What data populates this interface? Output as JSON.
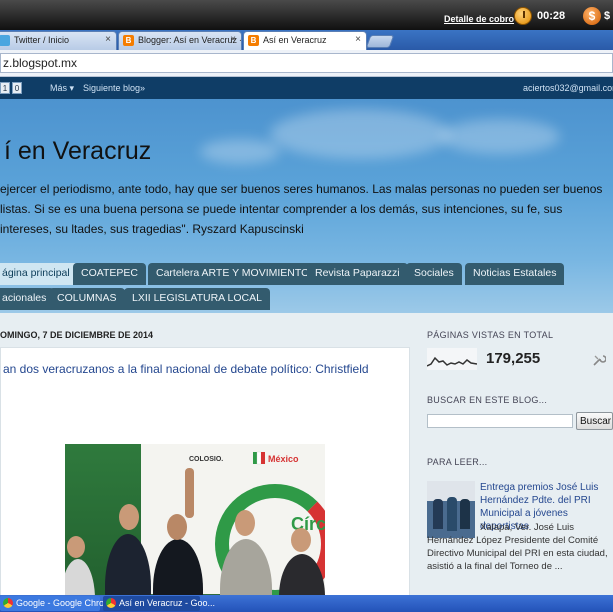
{
  "system_bar": {
    "billing_link": "Detalle de cobro",
    "time": "00:28",
    "money_symbol": "$",
    "money_text": "$"
  },
  "browser": {
    "tabs": [
      {
        "label": "Twitter / Inicio",
        "close": "×",
        "active": false
      },
      {
        "label": "Blogger: Así en Veracruz - Tú",
        "close": "×",
        "active": false
      },
      {
        "label": "Así en Veracruz",
        "close": "×",
        "active": true
      }
    ],
    "url": "z.blogspot.mx",
    "blogger_fav": "B"
  },
  "blogger_navbar": {
    "box1": "1",
    "box2": "0",
    "more_label": "Más ▾",
    "next_blog_label": "Siguiente blog»",
    "email": "aciertos032@gmail.com"
  },
  "blog": {
    "title": "í en Veracruz",
    "description": "ejercer el periodismo, ante todo, hay que ser buenos seres humanos. Las malas personas no pueden ser buenos listas. Si se es una buena persona se puede intentar comprender a los demás, sus intenciones, su fe, sus intereses, su ltades, sus tragedias\". Ryszard Kapuscinski",
    "nav_tabs_row1": [
      "ágina principal",
      "COATEPEC",
      "Cartelera ARTE Y MOVIMIENTO",
      "Revista Paparazzi",
      "Sociales",
      "Noticias Estatales"
    ],
    "nav_tabs_row2": [
      "acionales",
      "COLUMNAS",
      "LXII LEGISLATURA LOCAL"
    ]
  },
  "post": {
    "date_header": "OMINGO, 7 DE DICIEMBRE DE 2014",
    "title": "an dos veracruzanos a la final nacional de debate político: Christfield",
    "photo_text_colosio": "COLOSIO.",
    "photo_text_pri": "México",
    "photo_text_ring": "Círc"
  },
  "sidebar": {
    "pageviews_heading": "PÁGINAS VISTAS EN TOTAL",
    "pageviews_count": "179,255",
    "search_heading": "BUSCAR EN ESTE BLOG...",
    "search_button": "Buscar",
    "search_value": "",
    "read_heading": "PARA LEER...",
    "read_post_title": "Entrega premios José Luis Hernández Pdte. del PRI Municipal a jóvenes deportistas",
    "read_post_snippet": "Xalapa, Ver. José Luis Hernández López Presidente del Comité Directivo Municipal del PRI en esta ciudad, asistió a la final del Torneo de ..."
  },
  "taskbar": {
    "items": [
      {
        "label": "Google - Google Chrome"
      },
      {
        "label": "Así en Veracruz - Goo..."
      }
    ]
  },
  "colors": {
    "navbar_bg": "#0f3d66",
    "nav_tab_bg": "#335b6e",
    "nav_tab_active_bg": "#cfe6f2",
    "link_blue": "#24478f",
    "taskbar_blue": "#2352b8"
  },
  "icons": {
    "clock": "clock-icon",
    "money": "money-icon",
    "tool": "wrench-icon",
    "twitter": "twitter-favicon-icon",
    "blogger": "blogger-favicon-icon",
    "chrome": "chrome-icon"
  }
}
